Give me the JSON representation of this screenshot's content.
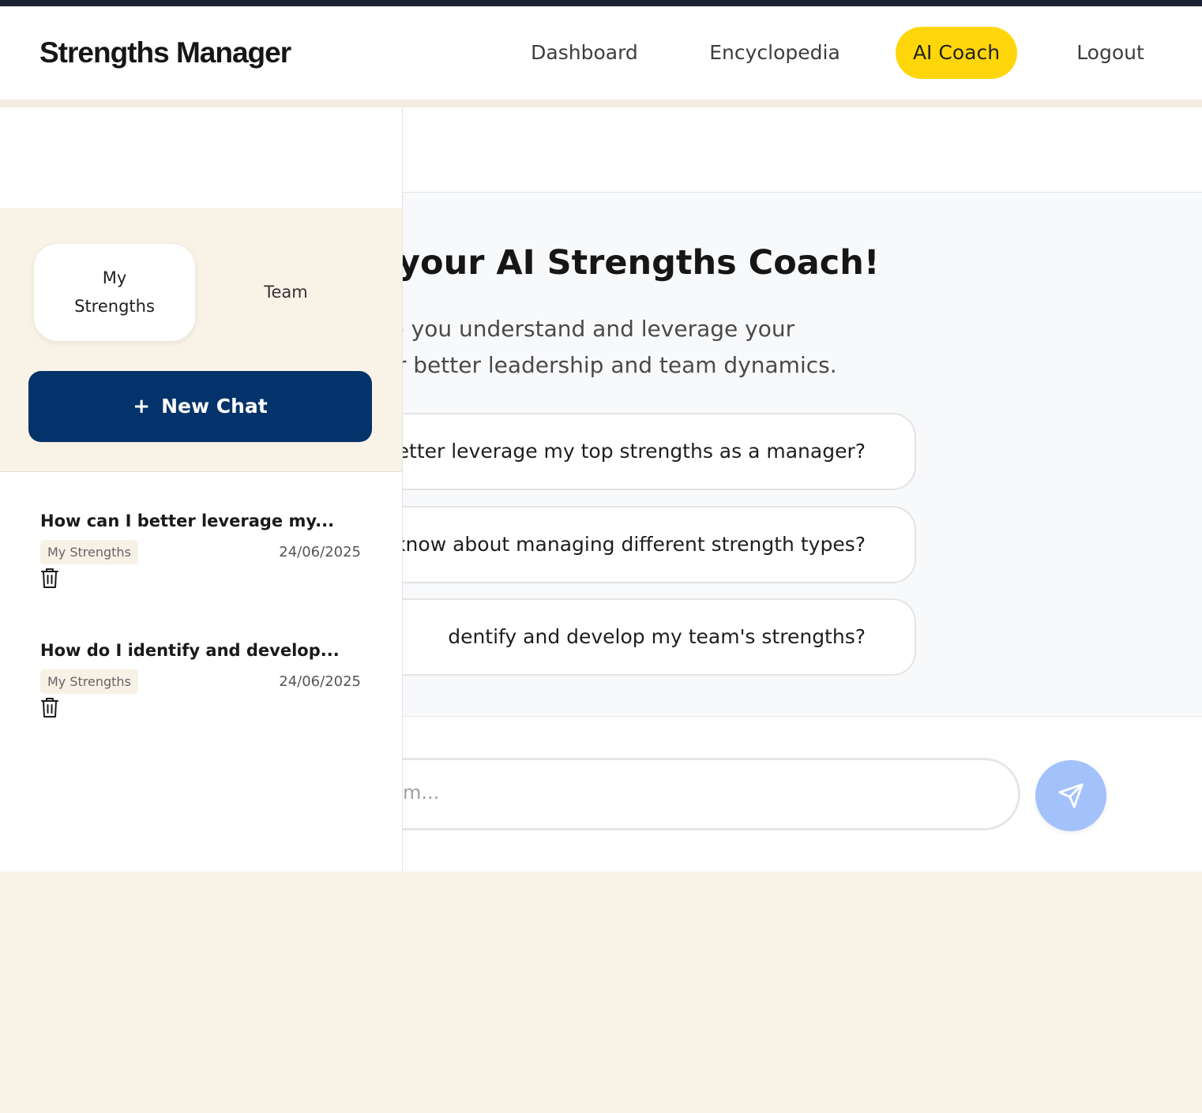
{
  "header": {
    "brand": "Strengths Manager",
    "nav": {
      "dashboard": "Dashboard",
      "encyclopedia": "Encyclopedia",
      "ai_coach": "AI Coach",
      "logout": "Logout"
    },
    "active_color": "#ffd60a"
  },
  "sidebar": {
    "tabs": {
      "my_strengths_line1": "My",
      "my_strengths_line2": "Strengths",
      "team": "Team"
    },
    "new_chat": {
      "icon": "+",
      "label": "New Chat"
    },
    "history": [
      {
        "title": "How can I better leverage my...",
        "tag": "My Strengths",
        "date": "24/06/2025",
        "icon": "trash-icon"
      },
      {
        "title": "How do I identify and develop...",
        "tag": "My Strengths",
        "date": "24/06/2025",
        "icon": "trash-icon"
      }
    ]
  },
  "main": {
    "welcome_title": "me to your AI Strengths Coach!",
    "welcome_line1": "ere to help you understand and leverage your",
    "welcome_line2": "rengths for better leadership and team dynamics.",
    "suggestions": [
      "better leverage my top strengths as a manager?",
      "uld I know about managing different strength types?",
      "dentify and develop my team's strengths?"
    ],
    "input_placeholder": "m...",
    "send_icon": "send-icon",
    "send_color": "#a3c1fb"
  },
  "colors": {
    "primary": "#03336a",
    "background": "#f9f2e7",
    "topstrip": "#1c2233"
  }
}
